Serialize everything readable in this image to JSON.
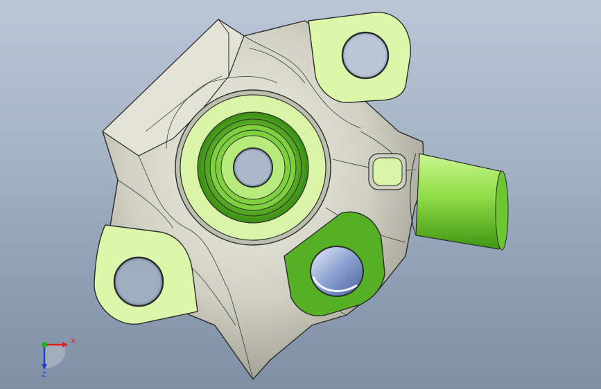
{
  "viewport": {
    "background_top": "#b9c6d6",
    "background_bottom": "#7f90a6"
  },
  "model": {
    "body_color": "#c4c4b6",
    "face_color_light": "#d8f5a8",
    "face_color_mid": "#8ddc4c",
    "face_color_dark": "#49a61c",
    "hole_color": "#6e88b8",
    "edge_color": "#2b2b2b"
  },
  "triad": {
    "x_label": "X",
    "z_label": "Z",
    "x_color": "#e02020",
    "y_color": "#20b020",
    "z_color": "#2040d0"
  }
}
